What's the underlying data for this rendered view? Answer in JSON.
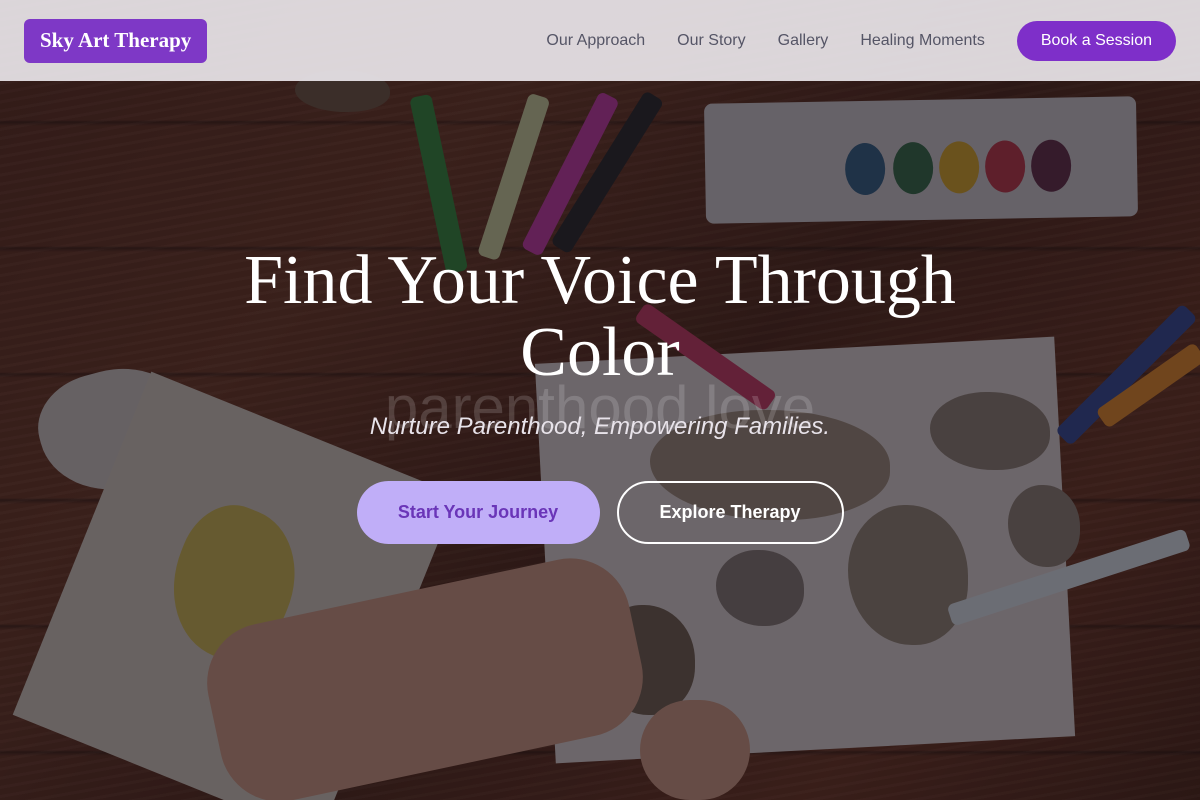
{
  "brand": {
    "name": "Sky Art Therapy",
    "accent_color": "#7e38c6"
  },
  "nav": {
    "links": [
      "Our Approach",
      "Our Story",
      "Gallery",
      "Healing Moments"
    ],
    "cta_label": "Book a Session"
  },
  "hero": {
    "title": "Find Your Voice Through Color",
    "watermark": "parenthood love",
    "tagline": "Nurture Parenthood, Empowering Families.",
    "primary_cta": "Start Your Journey",
    "secondary_cta": "Explore Therapy",
    "primary_cta_color": "#c0aef8"
  }
}
